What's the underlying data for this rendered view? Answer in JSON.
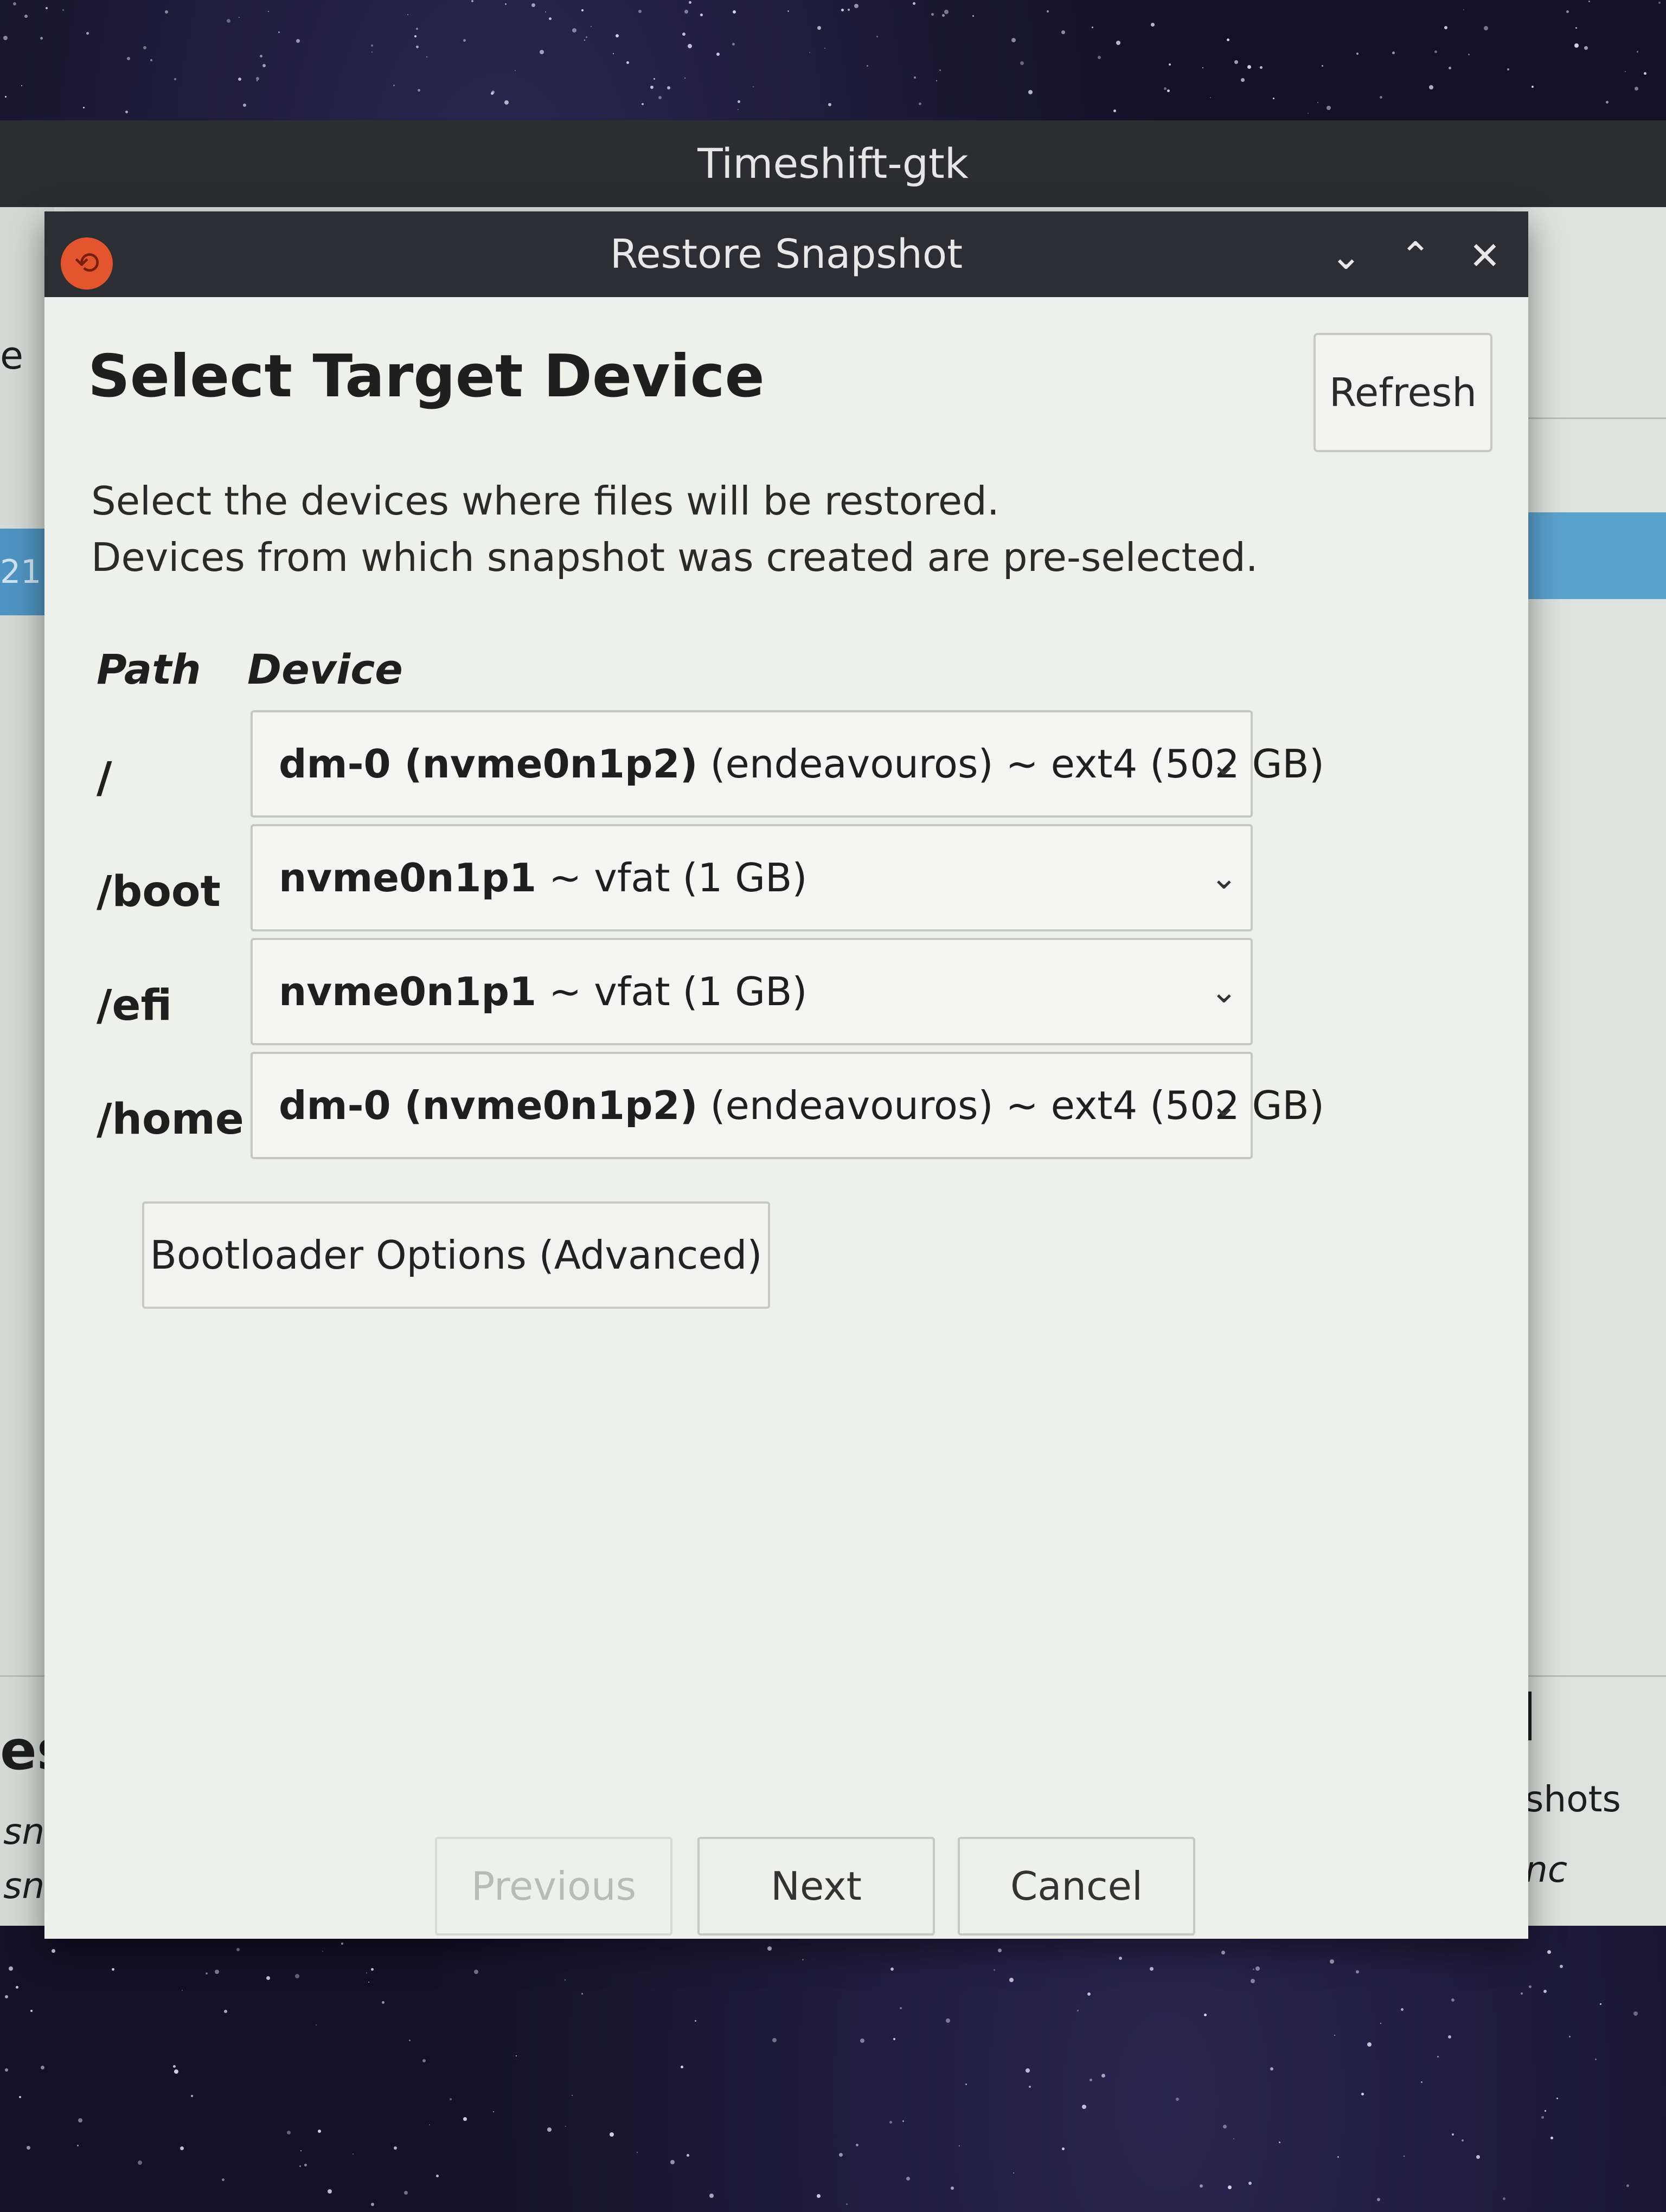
{
  "parent_window": {
    "title": "Timeshift-gtk",
    "left_fragments": [
      "e",
      "21",
      "esh",
      "snap",
      "snap"
    ],
    "right_fragments": [
      "shots",
      "nc"
    ]
  },
  "dialog": {
    "title": "Restore Snapshot",
    "icon": "timeshift-app-icon",
    "controls": {
      "minimize": "⌄",
      "maximize": "⌃",
      "close": "✕"
    },
    "heading": "Select Target Device",
    "refresh_label": "Refresh",
    "description_line1": "Select the devices where files will be restored.",
    "description_line2": "Devices from which snapshot was created are pre-selected.",
    "columns": {
      "path": "Path",
      "device": "Device"
    },
    "mappings": [
      {
        "path": "/",
        "device": "dm-0 (nvme0n1p2)",
        "detail": " (endeavouros) ~ ext4 (502 GB)"
      },
      {
        "path": "/boot",
        "device": "nvme0n1p1",
        "detail": " ~ vfat (1 GB)"
      },
      {
        "path": "/efi",
        "device": "nvme0n1p1",
        "detail": " ~ vfat (1 GB)"
      },
      {
        "path": "/home",
        "device": "dm-0 (nvme0n1p2)",
        "detail": " (endeavouros) ~ ext4 (502 GB)"
      }
    ],
    "bootloader_label": "Bootloader Options (Advanced)",
    "buttons": {
      "previous": "Previous",
      "next": "Next",
      "cancel": "Cancel"
    }
  }
}
